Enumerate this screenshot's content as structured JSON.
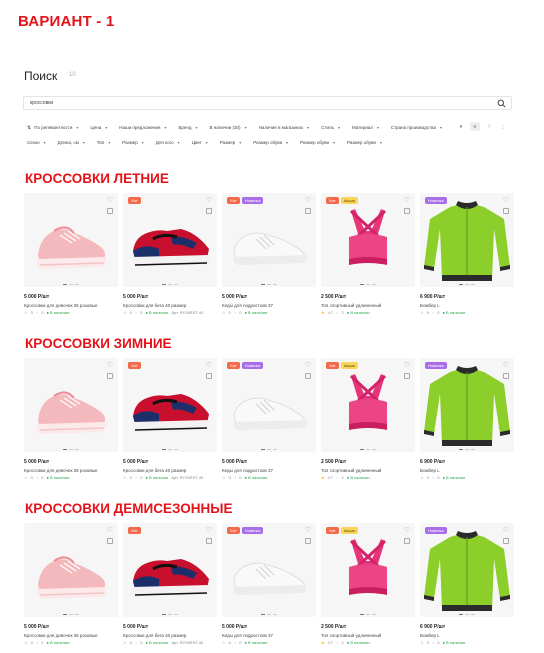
{
  "variant_title": "ВАРИАНТ - 1",
  "search": {
    "title": "Поиск",
    "count": "10",
    "query": "кроссовки"
  },
  "filters": [
    {
      "label": "По релевантности",
      "icon": "sort-icon"
    },
    {
      "label": "Цена"
    },
    {
      "label": "Наши предложения"
    },
    {
      "label": "Бренд"
    },
    {
      "label": "В наличии (30)"
    },
    {
      "label": "Наличие в магазинах"
    },
    {
      "label": "Стиль"
    },
    {
      "label": "Материал"
    },
    {
      "label": "Страна производства"
    },
    {
      "label": "Сезон"
    },
    {
      "label": "Длина, см"
    },
    {
      "label": "Тип"
    },
    {
      "label": "Размер"
    },
    {
      "label": "Для кого"
    },
    {
      "label": "Цвет"
    },
    {
      "label": "Размер"
    },
    {
      "label": "Размер обуви"
    },
    {
      "label": "Размер обуви"
    },
    {
      "label": "Размер обуви"
    }
  ],
  "view_modes": [
    "⏸",
    "≡",
    "⦙",
    "⋮"
  ],
  "sections": [
    {
      "title": "КРОССОВКИ ЛЕТНИЕ"
    },
    {
      "title": "КРОССОВКИ ЗИМНИЕ"
    },
    {
      "title": "КРОССОВКИ ДЕМИСЕЗОННЫЕ"
    }
  ],
  "products": [
    {
      "kind": "pink-sneaker",
      "badges": [],
      "price": "5 000 Р/шт",
      "name": "Кроссовки для девочек 25 розовые",
      "rating": "",
      "reviews": "0",
      "likes": "0",
      "stock": "В наличии",
      "code": ""
    },
    {
      "kind": "run-sneaker",
      "badges": [
        {
          "label": "Хит",
          "type": "hit"
        }
      ],
      "price": "5 000 Р/шт",
      "name": "Кроссовки для бега 40 размер",
      "rating": "",
      "reviews": "0",
      "likes": "0",
      "stock": "В наличии",
      "code": "Арт. RY26RST-40"
    },
    {
      "kind": "white-sneaker",
      "badges": [
        {
          "label": "Хит",
          "type": "hit"
        },
        {
          "label": "Новинка",
          "type": "new"
        }
      ],
      "price": "5 000 Р/шт",
      "name": "Кеды для подростков 37",
      "rating": "",
      "reviews": "0",
      "likes": "0",
      "stock": "В наличии",
      "code": ""
    },
    {
      "kind": "pink-top",
      "badges": [
        {
          "label": "Хит",
          "type": "hit"
        },
        {
          "label": "Акция",
          "type": "promo"
        }
      ],
      "price": "2 500 Р/шт",
      "name": "Топ спортивный удлиненный",
      "rating": "4.7",
      "reviews": "2",
      "likes": "",
      "stock": "В наличии",
      "code": ""
    },
    {
      "kind": "green-bomber",
      "badges": [
        {
          "label": "Новинка",
          "type": "new"
        }
      ],
      "price": "6 900 Р/шт",
      "name": "Бомбер L",
      "rating": "",
      "reviews": "0",
      "likes": "",
      "stock": "В наличии",
      "code": ""
    }
  ],
  "colors": {
    "accent_red": "#e4131a",
    "badge_hit": "#f26a4a",
    "badge_new": "#a86ee8",
    "badge_promo": "#f8d65a",
    "in_stock": "#2aa64b"
  }
}
